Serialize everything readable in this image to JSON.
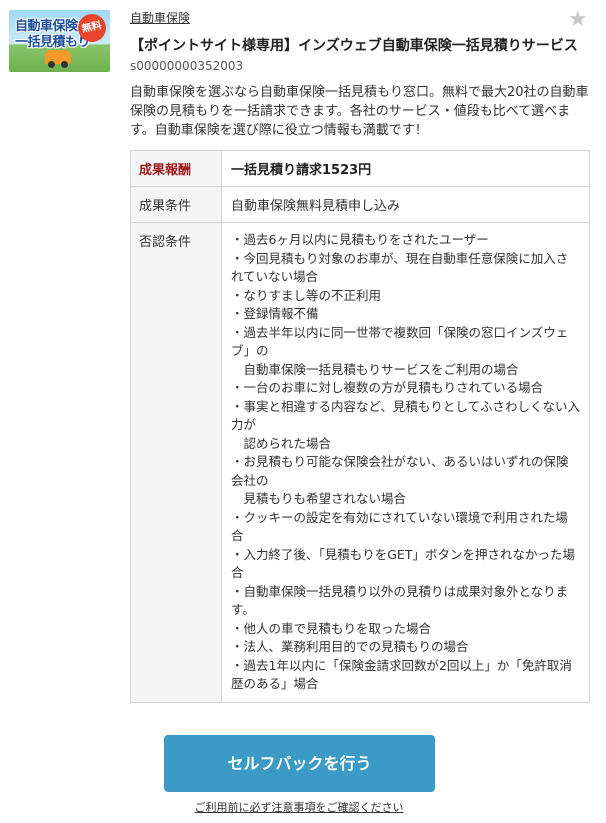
{
  "thumbnail": {
    "line1": "自動車保険",
    "line2": "一括見積もり",
    "badge": "無料"
  },
  "category": "自動車保険",
  "title": "【ポイントサイト様専用】インズウェブ自動車保険一括見積りサービス",
  "code": "s00000000352003",
  "description": "自動車保険を選ぶなら自動車保険一括見積もり窓口。無料で最大20社の自動車保険の見積もりを一括請求できます。各社のサービス・値段も比べて選べます。自動車保険を選び際に役立つ情報も満載です！",
  "conditions": {
    "reward_label": "成果報酬",
    "reward_value": "一括見積り請求1523円",
    "condition_label": "成果条件",
    "condition_value": "自動車保険無料見積申し込み",
    "denial_label": "否認条件",
    "denials": [
      "・過去6ヶ月以内に見積もりをされたユーザー",
      "・今回見積もり対象のお車が、現在自動車任意保険に加入されていない場合",
      "・なりすまし等の不正利用",
      "・登録情報不備",
      "・過去半年以内に同一世帯で複数回「保険の窓口インズウェブ」の",
      "　自動車保険一括見積もりサービスをご利用の場合",
      "・一台のお車に対し複数の方が見積もりされている場合",
      "・事実と相違する内容など、見積もりとしてふさわしくない入力が",
      "　認められた場合",
      "・お見積もり可能な保険会社がない、あるいはいずれの保険会社の",
      "　見積もりも希望されない場合",
      "・クッキーの設定を有効にされていない環境で利用された場合",
      "・入力終了後、「見積もりをGET」ボタンを押されなかった場合",
      "・自動車保険一括見積り以外の見積りは成果対象外となります。",
      "・他人の車で見積もりを取った場合",
      "・法人、業務利用目的での見積もりの場合",
      "・過去1年以内に「保険金請求回数が2回以上」か「免許取消歴のある」場合"
    ]
  },
  "cta_label": "セルフバックを行う",
  "notice_link": "ご利用前に必ず注意事項をご確認ください",
  "colors": {
    "cta": "#3c9bc6",
    "reward_label": "#a01c1c",
    "star": "#c8c8c8"
  }
}
